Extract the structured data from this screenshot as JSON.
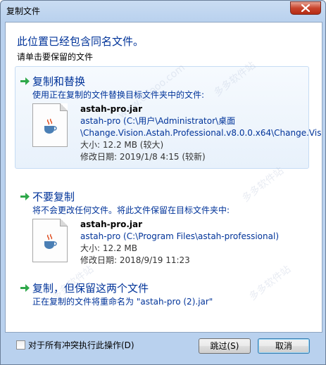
{
  "window": {
    "title": "复制文件",
    "close_icon": "close-icon"
  },
  "header": {
    "heading": "此位置已经包含同名文件。",
    "subheading": "请单击要保留的文件"
  },
  "options": [
    {
      "title": "复制和替换",
      "description": "使用正在复制的文件替换目标文件夹中的文件:",
      "file": {
        "name": "astah-pro.jar",
        "path_line1": "astah-pro (C:\\用户\\Administrator\\桌面",
        "path_line2": "\\Change.Vision.Astah.Professional.v8.0.0.x64\\Change.Vis",
        "size": "大小: 12.2 MB (较大)",
        "modified": "修改日期: 2019/1/8 4:15 (较新)"
      }
    },
    {
      "title": "不要复制",
      "description": "将不会更改任何文件。将此文件保留在目标文件夹中:",
      "file": {
        "name": "astah-pro.jar",
        "path_line1": "astah-pro (C:\\Program Files\\astah-professional)",
        "size": "大小: 12.2 MB",
        "modified": "修改日期: 2018/9/19 11:23"
      }
    },
    {
      "title": "复制，但保留这两个文件",
      "description": "正在复制的文件将重命名为 \"astah-pro (2).jar\""
    }
  ],
  "footer": {
    "checkbox_label": "对于所有冲突执行此操作(D)",
    "skip_label": "跳过(S)",
    "cancel_label": "取消"
  },
  "watermark": {
    "text": "多多软件站",
    "url": "www.ddooo.com"
  },
  "colors": {
    "link_blue": "#003399",
    "arrow_green": "#2ea84a",
    "frame_blue": "#b9d1ee"
  }
}
